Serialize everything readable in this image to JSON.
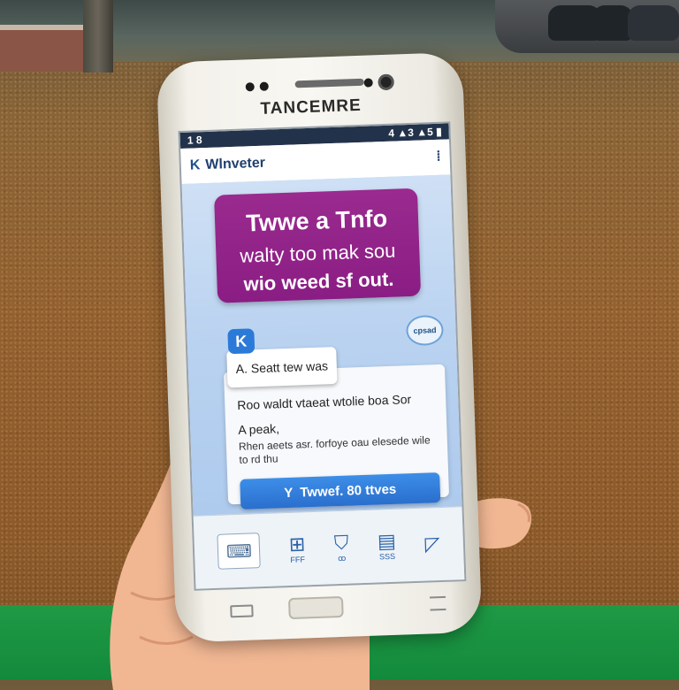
{
  "phone": {
    "brand": "TANCEMRE",
    "status_left": "1  8",
    "status_right": "4 ▲3 ▲5 ▮"
  },
  "app": {
    "logo_glyph": "K",
    "name": "Wlnveter",
    "menu_glyph": "⁞"
  },
  "promo": {
    "line1": "Twwe a Tnfo",
    "line2": "walty too mak sou",
    "line3": "wio weed sf out."
  },
  "bubble_label": "cpsad",
  "badge_glyph": "K",
  "chip_label": "A. Seatt tew was",
  "card": {
    "line1": "Roo waldt vtaeat wtolie boa Sor",
    "line2": "A peak,",
    "line3": "Rhen aeets asr. forfoye oau elesede wile to rd thu"
  },
  "cta": {
    "icon": "Y",
    "label": "Twwef. 80 ttves"
  },
  "dock": [
    {
      "icon_name": "keyboard-icon",
      "glyph": "⌨",
      "label": ""
    },
    {
      "icon_name": "bookmark-icon",
      "glyph": "⊞",
      "label": "FFF"
    },
    {
      "icon_name": "shirt-icon",
      "glyph": "⛉",
      "label": "ꝏ"
    },
    {
      "icon_name": "inbox-icon",
      "glyph": "▤",
      "label": "SSS"
    },
    {
      "icon_name": "send-icon",
      "glyph": "◸",
      "label": ""
    }
  ],
  "colors": {
    "promo": "#9a2a8e",
    "cta": "#2f7fd9",
    "statusbar": "#22324a",
    "floor": "#8c5a2a",
    "grass": "#1a9141"
  }
}
